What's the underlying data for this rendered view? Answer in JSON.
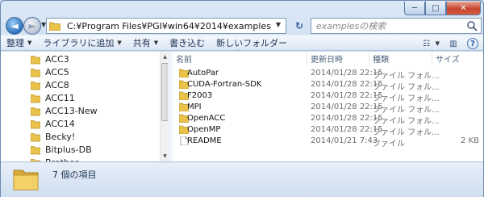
{
  "window": {
    "controls": {
      "minimize": "─",
      "maximize": "□",
      "close": "✕"
    }
  },
  "nav": {
    "back_glyph": "◄",
    "forward_glyph": "►",
    "address": "C:¥Program Files¥PGI¥win64¥2014¥examples",
    "refresh_glyph": "↻",
    "search_placeholder": "examplesの検索"
  },
  "toolbar": {
    "organize": "整理",
    "add_to_library": "ライブラリに追加",
    "share": "共有",
    "burn": "書き込む",
    "new_folder": "新しいフォルダー",
    "view_glyph": "☷",
    "preview_glyph": "▥",
    "help_glyph": "?"
  },
  "sidebar": {
    "items": [
      {
        "label": "ACC3"
      },
      {
        "label": "ACC5"
      },
      {
        "label": "ACC8"
      },
      {
        "label": "ACC11"
      },
      {
        "label": "ACC13-New"
      },
      {
        "label": "ACC14"
      },
      {
        "label": "Becky!"
      },
      {
        "label": "Bitplus-DB"
      },
      {
        "label": "Brother"
      }
    ]
  },
  "columns": {
    "name": "名前",
    "date": "更新日時",
    "type": "種類",
    "size": "サイズ"
  },
  "files": [
    {
      "name": "AutoPar",
      "date": "2014/01/28 22:15",
      "type": "ファイル フォル...",
      "size": "",
      "icon": "folder-icon"
    },
    {
      "name": "CUDA-Fortran-SDK",
      "date": "2014/01/28 22:15",
      "type": "ファイル フォル...",
      "size": "",
      "icon": "folder-icon"
    },
    {
      "name": "F2003",
      "date": "2014/01/28 22:15",
      "type": "ファイル フォル...",
      "size": "",
      "icon": "folder-icon"
    },
    {
      "name": "MPI",
      "date": "2014/01/28 22:15",
      "type": "ファイル フォル...",
      "size": "",
      "icon": "folder-icon"
    },
    {
      "name": "OpenACC",
      "date": "2014/01/28 22:15",
      "type": "ファイル フォル...",
      "size": "",
      "icon": "folder-icon"
    },
    {
      "name": "OpenMP",
      "date": "2014/01/28 22:15",
      "type": "ファイル フォル...",
      "size": "",
      "icon": "folder-icon"
    },
    {
      "name": "README",
      "date": "2014/01/21 7:43",
      "type": "ファイル",
      "size": "2 KB",
      "icon": "file-icon"
    }
  ],
  "status": {
    "item_count": "7 個の項目"
  },
  "colors": {
    "folder": "#e9c24a",
    "accent": "#2b6fbd",
    "titlebar": "#c3d6ec"
  }
}
